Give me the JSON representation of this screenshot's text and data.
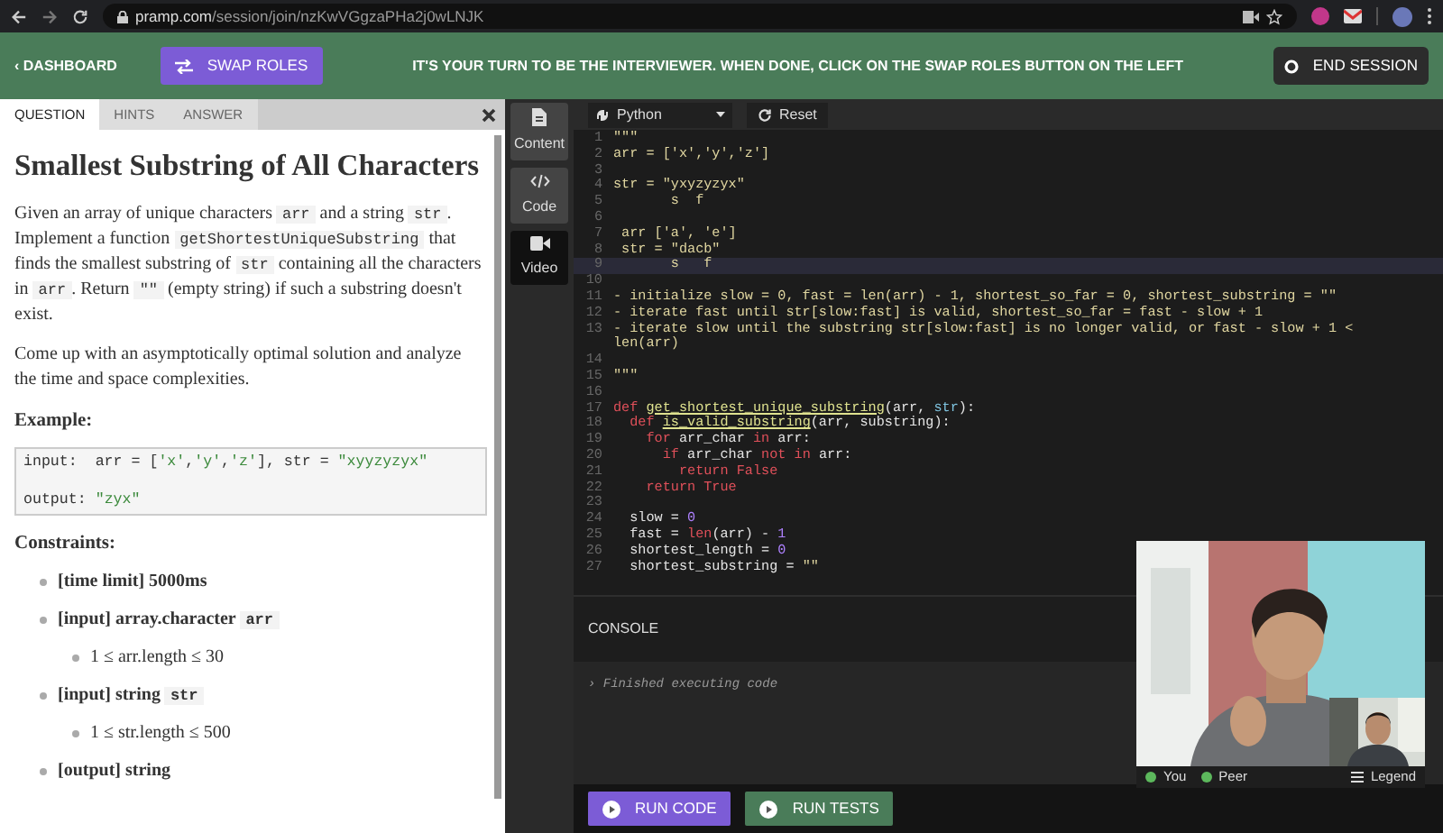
{
  "browser": {
    "host": "pramp.com",
    "path": "/session/join/nzKwVGgzaPHa2j0wLNJK"
  },
  "header": {
    "back_link": "‹ DASHBOARD",
    "swap_button": "SWAP ROLES",
    "message": "IT'S YOUR TURN TO BE THE INTERVIEWER. WHEN DONE, CLICK ON THE SWAP ROLES BUTTON ON THE LEFT",
    "end_button": "END SESSION"
  },
  "question_panel": {
    "tabs": [
      {
        "label": "QUESTION",
        "selected": true
      },
      {
        "label": "HINTS",
        "selected": false
      },
      {
        "label": "ANSWER",
        "selected": false
      }
    ],
    "title": "Smallest Substring of All Characters",
    "paragraphs": [
      [
        {
          "kind": "text",
          "text": "Given an array of unique characters "
        },
        {
          "kind": "code",
          "text": "arr"
        },
        {
          "kind": "text",
          "text": " and a string "
        },
        {
          "kind": "code",
          "text": "str"
        },
        {
          "kind": "text",
          "text": ". Implement a function "
        },
        {
          "kind": "code",
          "text": "getShortestUniqueSubstring"
        },
        {
          "kind": "text",
          "text": " that finds the smallest substring of "
        },
        {
          "kind": "code",
          "text": "str"
        },
        {
          "kind": "text",
          "text": " containing all the characters in "
        },
        {
          "kind": "code",
          "text": "arr"
        },
        {
          "kind": "text",
          "text": ". Return "
        },
        {
          "kind": "code",
          "text": "\"\""
        },
        {
          "kind": "text",
          "text": " (empty string) if such a substring doesn't exist."
        }
      ],
      [
        {
          "kind": "text",
          "text": "Come up with an asymptotically optimal solution and analyze the time and space complexities."
        }
      ]
    ],
    "example_heading": "Example:",
    "example_lines": [
      [
        {
          "kind": "plain",
          "text": "input:  arr = ["
        },
        {
          "kind": "str",
          "text": "'x'"
        },
        {
          "kind": "plain",
          "text": ","
        },
        {
          "kind": "str",
          "text": "'y'"
        },
        {
          "kind": "plain",
          "text": ","
        },
        {
          "kind": "str",
          "text": "'z'"
        },
        {
          "kind": "plain",
          "text": "], str = "
        },
        {
          "kind": "str",
          "text": "\"xyyzyzyx\""
        }
      ],
      [
        {
          "kind": "plain",
          "text": "output: "
        },
        {
          "kind": "str",
          "text": "\"zyx\""
        }
      ]
    ],
    "constraints_heading": "Constraints:",
    "constraints": [
      {
        "segments": [
          {
            "kind": "text",
            "text": "[time limit] 5000ms"
          }
        ]
      },
      {
        "segments": [
          {
            "kind": "text",
            "text": "[input] array.character "
          },
          {
            "kind": "code",
            "text": "arr"
          }
        ],
        "children": [
          {
            "text": "1 ≤ arr.length ≤ 30"
          }
        ]
      },
      {
        "segments": [
          {
            "kind": "text",
            "text": "[input] string "
          },
          {
            "kind": "code",
            "text": "str"
          }
        ],
        "children": [
          {
            "text": "1 ≤ str.length ≤ 500"
          }
        ]
      },
      {
        "segments": [
          {
            "kind": "text",
            "text": "[output] string"
          }
        ]
      }
    ]
  },
  "tools": [
    {
      "label": "Content",
      "kind": "file",
      "selected": true
    },
    {
      "label": "Code",
      "kind": "code",
      "selected": true
    },
    {
      "label": "Video",
      "kind": "camera",
      "selected": false
    }
  ],
  "editor": {
    "language": "Python",
    "reset": "Reset",
    "lines": [
      {
        "number": "1",
        "current": false,
        "segments": [
          {
            "kind": "doc",
            "text": "\"\"\""
          }
        ]
      },
      {
        "number": "2",
        "current": false,
        "segments": [
          {
            "kind": "doc",
            "text": "arr = ['x','y','z']"
          }
        ]
      },
      {
        "number": "3",
        "current": false
      },
      {
        "number": "4",
        "current": false,
        "segments": [
          {
            "kind": "doc",
            "text": "str = \"yxyzyzyx\""
          }
        ]
      },
      {
        "number": "5",
        "current": false,
        "segments": [
          {
            "kind": "doc",
            "text": "       s  f"
          }
        ]
      },
      {
        "number": "6",
        "current": false
      },
      {
        "number": "7",
        "current": false,
        "segments": [
          {
            "kind": "doc",
            "text": " arr ['a', 'e']"
          }
        ]
      },
      {
        "number": "8",
        "current": false,
        "segments": [
          {
            "kind": "doc",
            "text": " str = \"dacb\""
          }
        ]
      },
      {
        "number": "9",
        "current": true,
        "segments": [
          {
            "kind": "doc",
            "text": "       s   f"
          }
        ]
      },
      {
        "number": "10",
        "current": false
      },
      {
        "number": "11",
        "current": false,
        "segments": [
          {
            "kind": "doc",
            "text": "- initialize slow = 0, fast = len(arr) - 1, shortest_so_far = 0, shortest_substring = \"\""
          }
        ]
      },
      {
        "number": "12",
        "current": false,
        "segments": [
          {
            "kind": "doc",
            "text": "- iterate fast until str[slow:fast] is valid, shortest_so_far = fast - slow + 1"
          }
        ]
      },
      {
        "number": "13",
        "current": false,
        "segments": [
          {
            "kind": "doc",
            "text": "- iterate slow until the substring str[slow:fast] is no longer valid, or fast - slow + 1 <"
          }
        ]
      },
      {
        "current": false,
        "segments": [
          {
            "kind": "doc",
            "text": "len(arr)"
          }
        ]
      },
      {
        "number": "14",
        "current": false
      },
      {
        "number": "15",
        "current": false,
        "segments": [
          {
            "kind": "doc",
            "text": "\"\"\""
          }
        ]
      },
      {
        "number": "16",
        "current": false
      },
      {
        "number": "17",
        "current": false,
        "segments": [
          {
            "kind": "keyword",
            "text": "def "
          },
          {
            "kind": "func",
            "text": "get_shortest_unique_substring"
          },
          {
            "kind": "plain",
            "text": "(arr, "
          },
          {
            "kind": "param",
            "text": "str"
          },
          {
            "kind": "plain",
            "text": "):"
          }
        ]
      },
      {
        "number": "18",
        "current": false,
        "segments": [
          {
            "kind": "keyword",
            "text": "  def "
          },
          {
            "kind": "func",
            "text": "is_valid_substring"
          },
          {
            "kind": "plain",
            "text": "(arr, substring):"
          }
        ]
      },
      {
        "number": "19",
        "current": false,
        "segments": [
          {
            "kind": "keyword",
            "text": "    for"
          },
          {
            "kind": "plain",
            "text": " arr_char "
          },
          {
            "kind": "keyword",
            "text": "in"
          },
          {
            "kind": "plain",
            "text": " arr:"
          }
        ]
      },
      {
        "number": "20",
        "current": false,
        "segments": [
          {
            "kind": "keyword",
            "text": "      if"
          },
          {
            "kind": "plain",
            "text": " arr_char "
          },
          {
            "kind": "keyword",
            "text": "not in"
          },
          {
            "kind": "plain",
            "text": " arr:"
          }
        ]
      },
      {
        "number": "21",
        "current": false,
        "segments": [
          {
            "kind": "keyword",
            "text": "        return False"
          }
        ]
      },
      {
        "number": "22",
        "current": false,
        "segments": [
          {
            "kind": "keyword",
            "text": "    return True"
          }
        ]
      },
      {
        "number": "23",
        "current": false
      },
      {
        "number": "24",
        "current": false,
        "segments": [
          {
            "kind": "plain",
            "text": "  slow = "
          },
          {
            "kind": "number",
            "text": "0"
          }
        ]
      },
      {
        "number": "25",
        "current": false,
        "segments": [
          {
            "kind": "plain",
            "text": "  fast = "
          },
          {
            "kind": "keyword",
            "text": "len"
          },
          {
            "kind": "plain",
            "text": "(arr) - "
          },
          {
            "kind": "number",
            "text": "1"
          }
        ]
      },
      {
        "number": "26",
        "current": false,
        "segments": [
          {
            "kind": "plain",
            "text": "  shortest_length = "
          },
          {
            "kind": "number",
            "text": "0"
          }
        ]
      },
      {
        "number": "27",
        "current": false,
        "segments": [
          {
            "kind": "plain",
            "text": "  shortest_substring = "
          },
          {
            "kind": "doc",
            "text": "\"\""
          }
        ]
      }
    ]
  },
  "console": {
    "title": "CONSOLE",
    "output": "› Finished executing code"
  },
  "run_buttons": [
    {
      "label": "RUN CODE",
      "kind": "primary"
    },
    {
      "label": "RUN TESTS",
      "kind": "success"
    }
  ],
  "video": {
    "kind": "picture",
    "participants": [
      {
        "label": "You",
        "color": "#5cb85c"
      },
      {
        "label": "Peer",
        "color": "#5cb85c"
      }
    ],
    "legend": "Legend"
  }
}
